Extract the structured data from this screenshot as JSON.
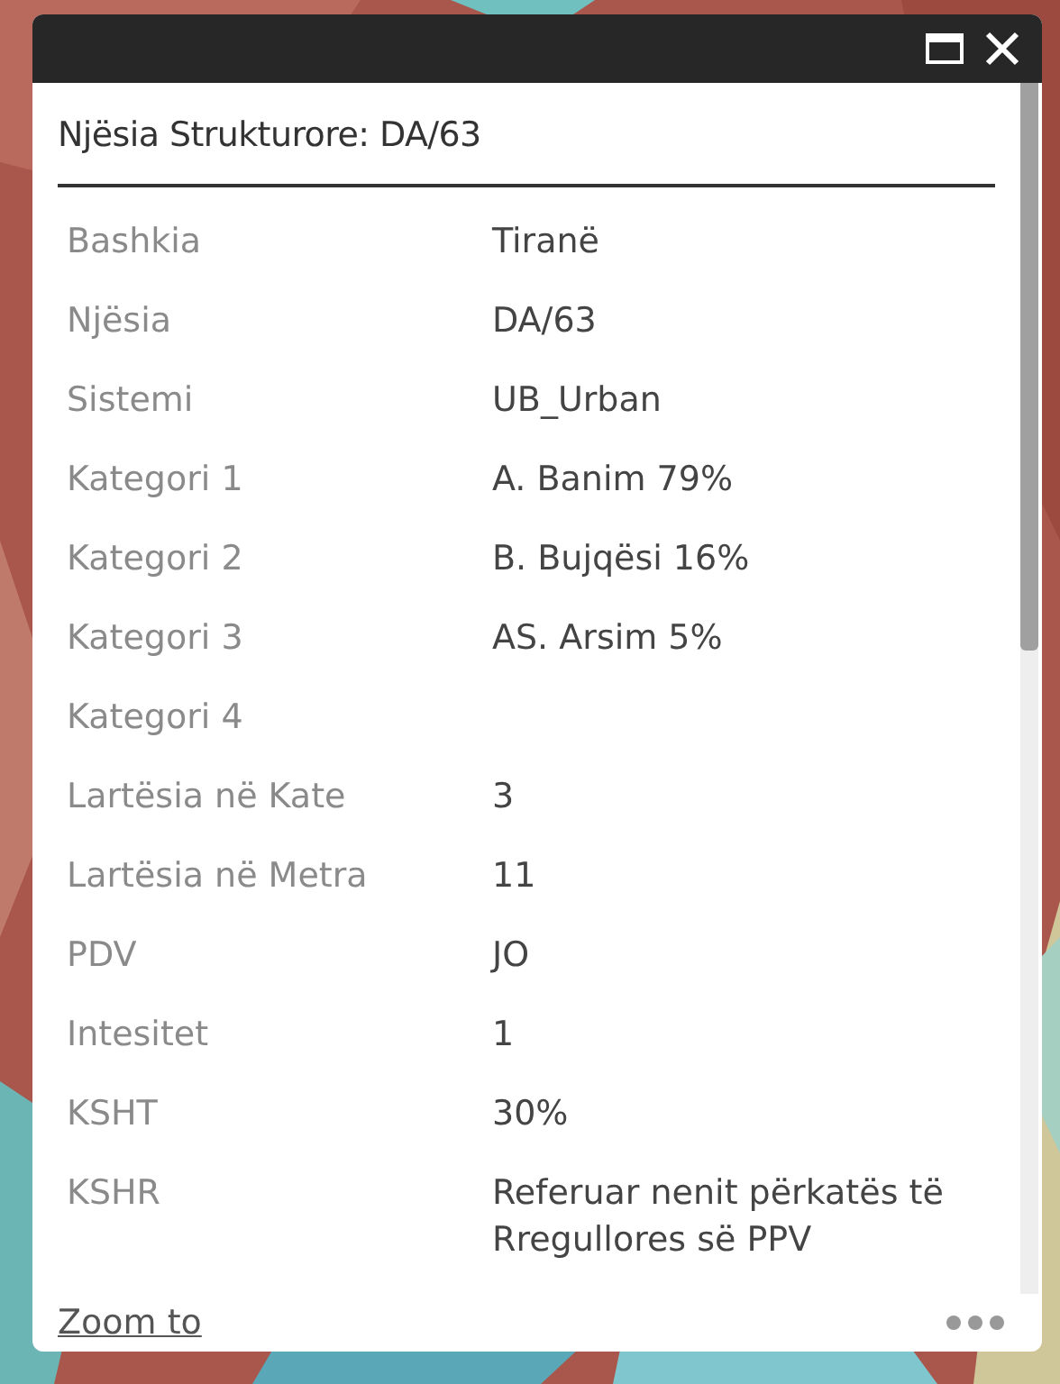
{
  "popup": {
    "title": "Njësia Strukturore: DA/63",
    "fields": [
      {
        "label": "Bashkia",
        "value": "Tiranë"
      },
      {
        "label": "Njësia",
        "value": "DA/63"
      },
      {
        "label": "Sistemi",
        "value": "UB_Urban"
      },
      {
        "label": "Kategori 1",
        "value": "A. Banim 79%"
      },
      {
        "label": "Kategori 2",
        "value": "B. Bujqësi 16%"
      },
      {
        "label": "Kategori 3",
        "value": "AS. Arsim 5%"
      },
      {
        "label": "Kategori 4"
      },
      {
        "label": "Lartësia në Kate",
        "value": "3"
      },
      {
        "label": "Lartësia në Metra",
        "value": "11"
      },
      {
        "label": "PDV",
        "value": "JO"
      },
      {
        "label": "Intesitet",
        "value": "1"
      },
      {
        "label": "KSHT",
        "value": "30%"
      },
      {
        "label": "KSHR",
        "value": "Referuar nenit përkatës të Rregullores së PPV"
      }
    ],
    "footer_link": "Zoom to"
  }
}
